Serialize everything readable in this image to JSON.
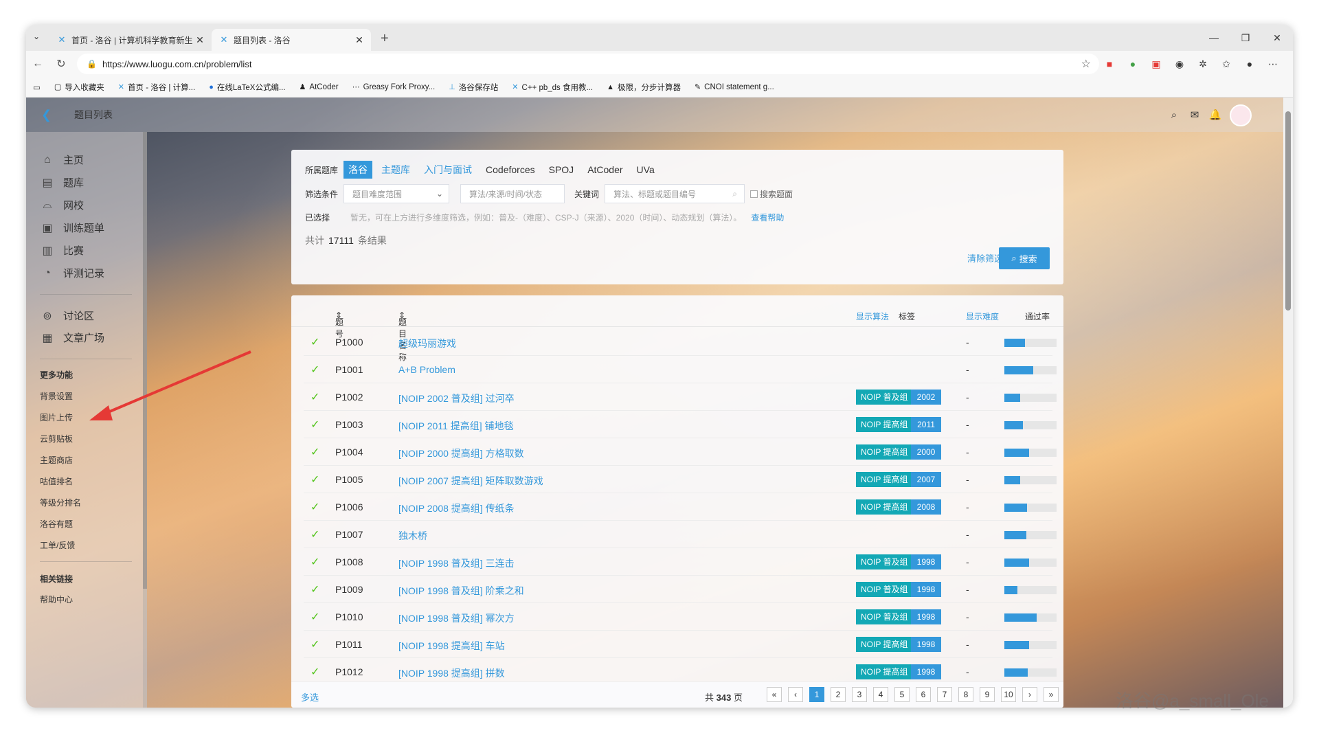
{
  "browser": {
    "tabs": [
      {
        "title": "首页 - 洛谷 | 计算机科学教育新生"
      },
      {
        "title": "题目列表 - 洛谷"
      }
    ],
    "url": "https://www.luogu.com.cn/problem/list",
    "bookmarks": [
      "导入收藏夹",
      "首页 - 洛谷 | 计算...",
      "在线LaTeX公式编...",
      "AtCoder",
      "Greasy Fork Proxy...",
      "洛谷保存站",
      "C++ pb_ds 食用教...",
      "极限，分步计算器",
      "CNOI statement g..."
    ]
  },
  "header": {
    "title": "题目列表"
  },
  "sidebar": {
    "main": [
      {
        "icon": "⌂",
        "label": "主页"
      },
      {
        "icon": "▤",
        "label": "题库"
      },
      {
        "icon": "⌓",
        "label": "网校"
      },
      {
        "icon": "▣",
        "label": "训练题单"
      },
      {
        "icon": "▥",
        "label": "比赛"
      },
      {
        "icon": "◔",
        "label": "评测记录"
      }
    ],
    "social": [
      {
        "icon": "⊚",
        "label": "讨论区"
      },
      {
        "icon": "▦",
        "label": "文章广场"
      }
    ],
    "more_heading": "更多功能",
    "more": [
      "背景设置",
      "图片上传",
      "云剪贴板",
      "主题商店",
      "咕值排名",
      "等级分排名",
      "洛谷有题",
      "工单/反馈"
    ],
    "links_heading": "相关链接",
    "links": [
      "帮助中心"
    ]
  },
  "filter": {
    "lib_label": "所属题库",
    "libs": [
      "洛谷",
      "主题库",
      "入门与面试",
      "Codeforces",
      "SPOJ",
      "AtCoder",
      "UVa"
    ],
    "cond_label": "筛选条件",
    "difficulty_placeholder": "题目难度范围",
    "algo_placeholder": "算法/来源/时间/状态",
    "keyword_label": "关键词",
    "keyword_placeholder": "算法、标题或题目编号",
    "search_stmt": "搜索题面",
    "selected_label": "已选择",
    "selected_hint": "暂无，可在上方进行多维度筛选，例如：普及-（难度）、CSP-J（来源）、2020（时间）、动态规划（算法）。",
    "help": "查看帮助",
    "count_prefix": "共计",
    "count": "17111",
    "count_suffix": "条结果",
    "clear": "清除筛选",
    "search": "搜索"
  },
  "table": {
    "col_id": "题号",
    "col_name": "题目名称",
    "show_algo": "显示算法",
    "col_tags": "标签",
    "show_diff": "显示难度",
    "col_pass": "通过率",
    "rows": [
      {
        "id": "P1000",
        "name": "超级玛丽游戏",
        "tag": "",
        "year": "",
        "diff": "-",
        "pass": 0.4
      },
      {
        "id": "P1001",
        "name": "A+B Problem",
        "tag": "",
        "year": "",
        "diff": "-",
        "pass": 0.55
      },
      {
        "id": "P1002",
        "name": "[NOIP 2002 普及组] 过河卒",
        "tag": "NOIP 普及组",
        "year": "2002",
        "diff": "-",
        "pass": 0.3
      },
      {
        "id": "P1003",
        "name": "[NOIP 2011 提高组] 铺地毯",
        "tag": "NOIP 提高组",
        "year": "2011",
        "diff": "-",
        "pass": 0.35
      },
      {
        "id": "P1004",
        "name": "[NOIP 2000 提高组] 方格取数",
        "tag": "NOIP 提高组",
        "year": "2000",
        "diff": "-",
        "pass": 0.48
      },
      {
        "id": "P1005",
        "name": "[NOIP 2007 提高组] 矩阵取数游戏",
        "tag": "NOIP 提高组",
        "year": "2007",
        "diff": "-",
        "pass": 0.3
      },
      {
        "id": "P1006",
        "name": "[NOIP 2008 提高组] 传纸条",
        "tag": "NOIP 提高组",
        "year": "2008",
        "diff": "-",
        "pass": 0.43
      },
      {
        "id": "P1007",
        "name": "独木桥",
        "tag": "",
        "year": "",
        "diff": "-",
        "pass": 0.42
      },
      {
        "id": "P1008",
        "name": "[NOIP 1998 普及组] 三连击",
        "tag": "NOIP 普及组",
        "year": "1998",
        "diff": "-",
        "pass": 0.48
      },
      {
        "id": "P1009",
        "name": "[NOIP 1998 普及组] 阶乘之和",
        "tag": "NOIP 普及组",
        "year": "1998",
        "diff": "-",
        "pass": 0.25
      },
      {
        "id": "P1010",
        "name": "[NOIP 1998 普及组] 幂次方",
        "tag": "NOIP 普及组",
        "year": "1998",
        "diff": "-",
        "pass": 0.62
      },
      {
        "id": "P1011",
        "name": "[NOIP 1998 提高组] 车站",
        "tag": "NOIP 提高组",
        "year": "1998",
        "diff": "-",
        "pass": 0.48
      },
      {
        "id": "P1012",
        "name": "[NOIP 1998 提高组] 拼数",
        "tag": "NOIP 提高组",
        "year": "1998",
        "diff": "-",
        "pass": 0.45
      }
    ]
  },
  "pager": {
    "multi": "多选",
    "total_prefix": "共",
    "total": "343",
    "total_suffix": "页",
    "pages": [
      "1",
      "2",
      "3",
      "4",
      "5",
      "6",
      "7",
      "8",
      "9",
      "10"
    ]
  },
  "watermark": "洛谷@a_small_Ole"
}
